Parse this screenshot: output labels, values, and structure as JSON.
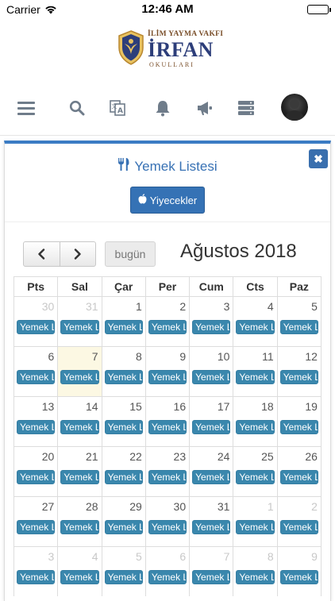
{
  "status_bar": {
    "carrier": "Carrier",
    "time": "12:46 AM"
  },
  "logo": {
    "top_text": "İLİM YAYMA VAKFI",
    "main_text": "İRFAN",
    "sub_text": "OKULLARI"
  },
  "navbar": {
    "icons": [
      "menu-icon",
      "search-icon",
      "translate-icon",
      "bell-icon",
      "megaphone-icon",
      "list-icon"
    ]
  },
  "panel": {
    "title": "Yemek Listesi",
    "title_icon": "cutlery-icon",
    "food_button_label": "Yiyecekler",
    "food_button_icon": "apple-icon",
    "close_label": "✖"
  },
  "calendar": {
    "prev_label": "‹",
    "next_label": "›",
    "today_label": "bugün",
    "month_title": "Ağustos 2018",
    "weekdays": [
      "Pts",
      "Sal",
      "Çar",
      "Per",
      "Cum",
      "Cts",
      "Paz"
    ],
    "event_label": "Yemek L",
    "weeks": [
      {
        "days": [
          "30",
          "31",
          "1",
          "2",
          "3",
          "4",
          "5"
        ],
        "other": [
          true,
          true,
          false,
          false,
          false,
          false,
          false
        ]
      },
      {
        "days": [
          "6",
          "7",
          "8",
          "9",
          "10",
          "11",
          "12"
        ],
        "other": [
          false,
          false,
          false,
          false,
          false,
          false,
          false
        ]
      },
      {
        "days": [
          "13",
          "14",
          "15",
          "16",
          "17",
          "18",
          "19"
        ],
        "other": [
          false,
          false,
          false,
          false,
          false,
          false,
          false
        ]
      },
      {
        "days": [
          "20",
          "21",
          "22",
          "23",
          "24",
          "25",
          "26"
        ],
        "other": [
          false,
          false,
          false,
          false,
          false,
          false,
          false
        ]
      },
      {
        "days": [
          "27",
          "28",
          "29",
          "30",
          "31",
          "1",
          "2"
        ],
        "other": [
          false,
          false,
          false,
          false,
          false,
          true,
          true
        ]
      },
      {
        "days": [
          "3",
          "4",
          "5",
          "6",
          "7",
          "8",
          "9"
        ],
        "other": [
          true,
          true,
          true,
          true,
          true,
          true,
          true
        ]
      }
    ],
    "today": "7"
  },
  "colors": {
    "accent": "#3b7cc4",
    "event": "#3a87ad",
    "today_bg": "#fcf8e3",
    "nav_icon": "#6f7c8a"
  }
}
